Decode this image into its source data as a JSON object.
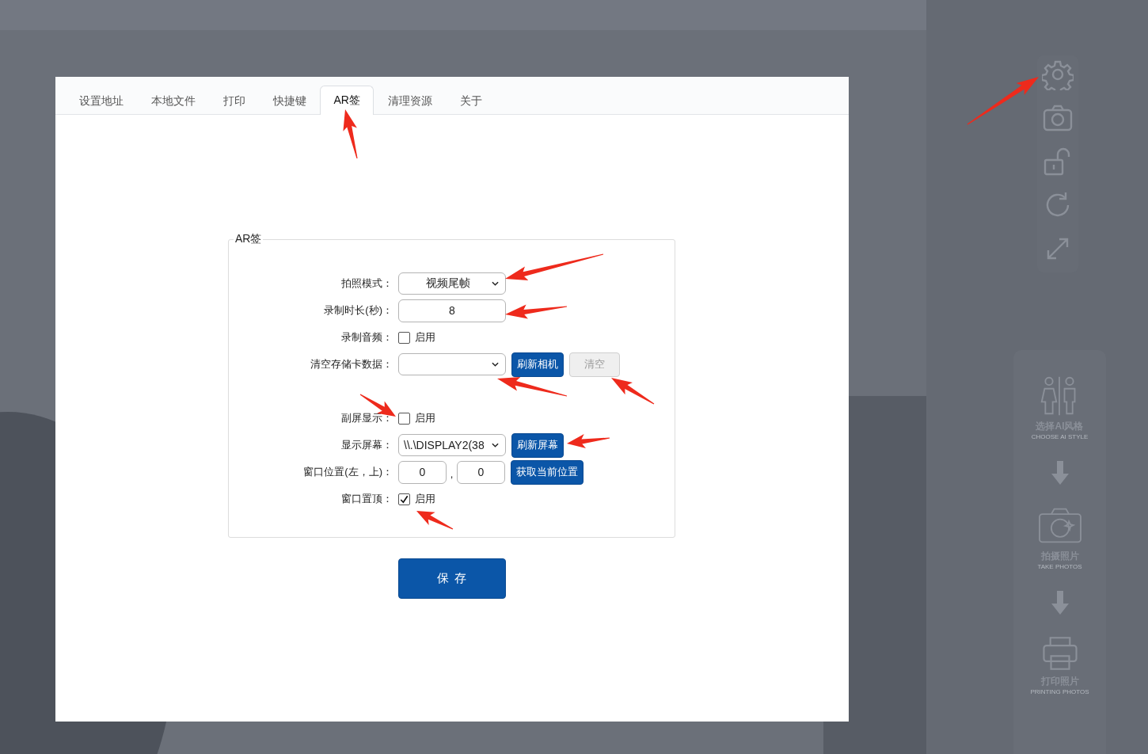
{
  "tabs": [
    {
      "label": "设置地址",
      "selected": false
    },
    {
      "label": "本地文件",
      "selected": false
    },
    {
      "label": "打印",
      "selected": false
    },
    {
      "label": "快捷键",
      "selected": false
    },
    {
      "label": "AR签",
      "selected": true
    },
    {
      "label": "清理资源",
      "selected": false
    },
    {
      "label": "关于",
      "selected": false
    }
  ],
  "fieldset": {
    "legend": "AR签",
    "groups": [
      [
        {
          "kind": "select",
          "label": "拍照模式：",
          "value": "视频尾帧",
          "centered": true
        },
        {
          "kind": "input",
          "label": "录制时长(秒)：",
          "value": "8"
        },
        {
          "kind": "checkbox",
          "label": "录制音频：",
          "option": "启用",
          "checked": false
        },
        {
          "kind": "select",
          "label": "清空存储卡数据：",
          "centered": false,
          "buttons": [
            {
              "label": "刷新相机",
              "disabled": false
            },
            {
              "label": "清空",
              "disabled": true
            }
          ]
        }
      ],
      [
        {
          "kind": "checkbox",
          "label": "副屏显示：",
          "option": "启用",
          "checked": false
        },
        {
          "kind": "select",
          "label": "显示屏幕：",
          "value": "\\\\.\\DISPLAY2(38",
          "centered": false,
          "buttons": [
            {
              "label": "刷新屏幕",
              "disabled": false
            }
          ]
        },
        {
          "kind": "pair",
          "label": "窗口位置(左，上)：",
          "values": [
            "0",
            "0"
          ],
          "separator": ",",
          "buttons": [
            {
              "label": "获取当前位置",
              "disabled": false
            }
          ]
        },
        {
          "kind": "checkbox",
          "label": "窗口置顶：",
          "option": "启用",
          "checked": true
        }
      ]
    ]
  },
  "save_button": "保 存",
  "sidebar": {
    "steps": [
      {
        "title": "选择AI风格",
        "subtitle": "CHOOSE AI STYLE"
      },
      {
        "title": "拍摄照片",
        "subtitle": "TAKE PHOTOS"
      },
      {
        "title": "打印照片",
        "subtitle": "PRINTING PHOTOS"
      }
    ]
  }
}
